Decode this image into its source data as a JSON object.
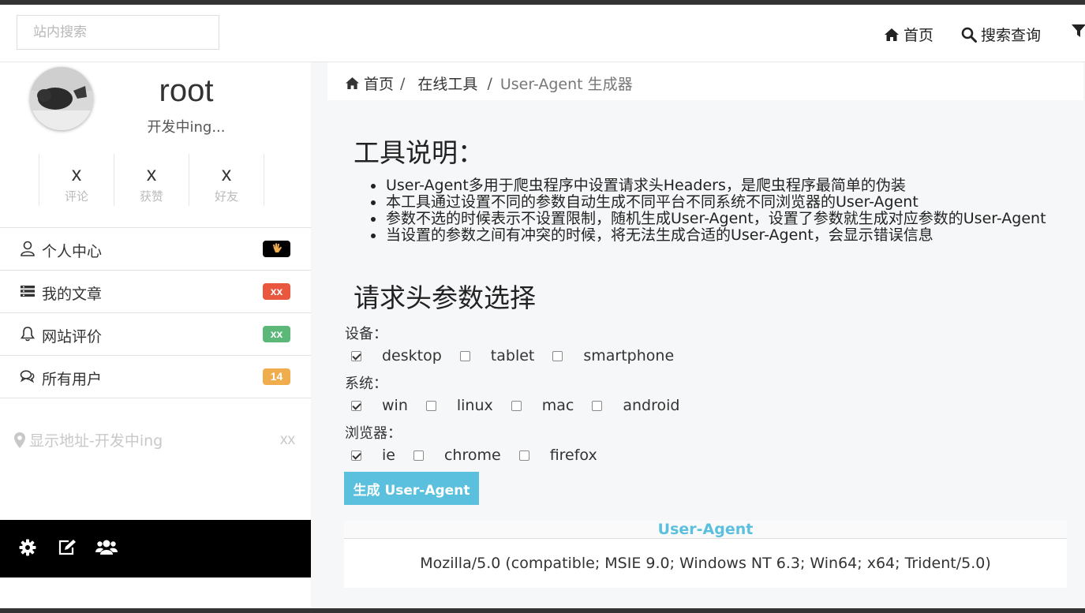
{
  "header": {
    "search_placeholder": "站内搜索",
    "nav": [
      {
        "label": "首页",
        "icon": "home-icon"
      },
      {
        "label": "搜索查询",
        "icon": "search-icon"
      }
    ]
  },
  "profile": {
    "username": "root",
    "subtitle": "开发中ing...",
    "stats": [
      {
        "value": "x",
        "label": "评论"
      },
      {
        "value": "x",
        "label": "获赞"
      },
      {
        "value": "x",
        "label": "好友"
      }
    ]
  },
  "menu": [
    {
      "label": "个人中心",
      "icon": "user-icon",
      "badge_color": "#000000"
    },
    {
      "label": "我的文章",
      "icon": "list-icon",
      "badge": "xx",
      "badge_color": "#e8573e"
    },
    {
      "label": "网站评价",
      "icon": "bell-icon",
      "badge": "xx",
      "badge_color": "#5cb878"
    },
    {
      "label": "所有用户",
      "icon": "comments-icon",
      "badge": "14",
      "badge_color": "#f0ad4e"
    }
  ],
  "location": {
    "label": "显示地址-开发中ing",
    "value": "xx"
  },
  "footer_icons": [
    "gear-icon",
    "edit-icon",
    "users-icon"
  ],
  "breadcrumb": {
    "home": "首页",
    "sep": "/",
    "section": "在线工具",
    "current": "User-Agent 生成器"
  },
  "tool": {
    "desc_title": "工具说明：",
    "desc_items": [
      "User-Agent多用于爬虫程序中设置请求头Headers，是爬虫程序最简单的伪装",
      "本工具通过设置不同的参数自动生成不同平台不同系统不同浏览器的User-Agent",
      "参数不选的时候表示不设置限制，随机生成User-Agent，设置了参数就生成对应参数的User-Agent",
      "当设置的参数之间有冲突的时候，将无法生成合适的User-Agent，会显示错误信息"
    ],
    "params_title": "请求头参数选择",
    "groups": [
      {
        "label": "设备：",
        "options": [
          {
            "label": "desktop",
            "checked": true
          },
          {
            "label": "tablet",
            "checked": false
          },
          {
            "label": "smartphone",
            "checked": false
          }
        ]
      },
      {
        "label": "系统：",
        "options": [
          {
            "label": "win",
            "checked": true
          },
          {
            "label": "linux",
            "checked": false
          },
          {
            "label": "mac",
            "checked": false
          },
          {
            "label": "android",
            "checked": false
          }
        ]
      },
      {
        "label": "浏览器：",
        "options": [
          {
            "label": "ie",
            "checked": true
          },
          {
            "label": "chrome",
            "checked": false
          },
          {
            "label": "firefox",
            "checked": false
          }
        ]
      }
    ],
    "generate_label": "生成 User-Agent",
    "result_title": "User-Agent",
    "result_value": "Mozilla/5.0 (compatible; MSIE 9.0; Windows NT 6.3; Win64; x64; Trident/5.0)"
  },
  "colors": {
    "accent": "#5bc0de",
    "footer_bg": "#000000"
  }
}
